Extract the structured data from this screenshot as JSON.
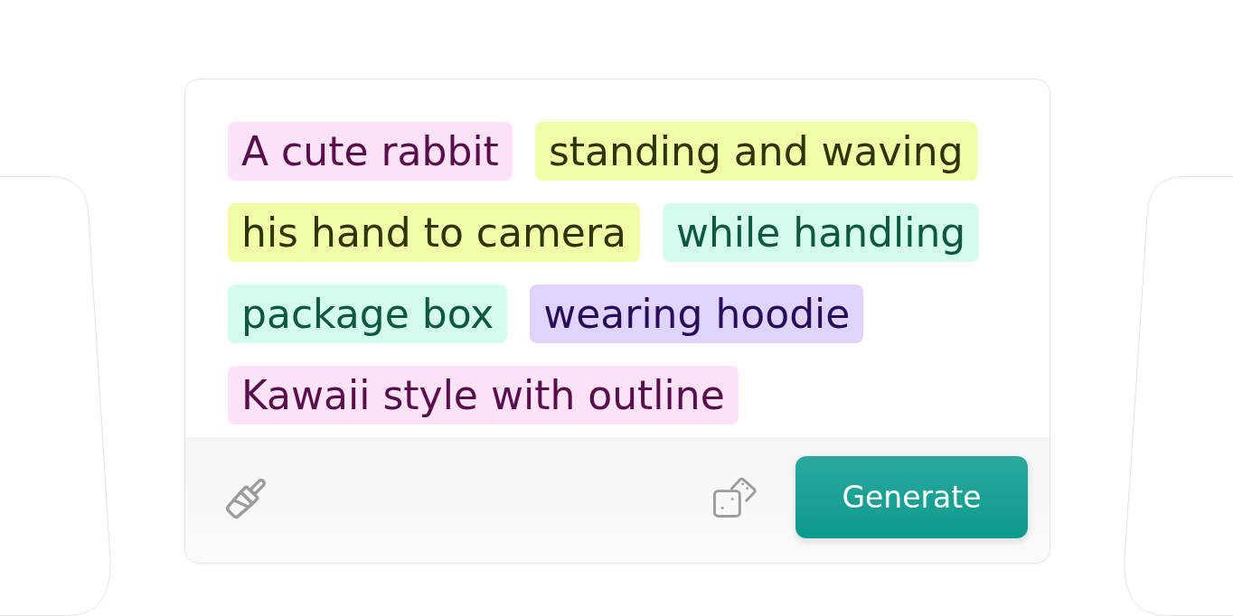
{
  "prompt": {
    "tags": [
      {
        "text": "A cute rabbit",
        "color": "#fde2f8"
      },
      {
        "text": "standing and waving",
        "color": "#f3fca7"
      },
      {
        "text": "his hand to camera",
        "color": "#f3fca7"
      },
      {
        "text": "while handling",
        "color": "#d3fcef"
      },
      {
        "text": "package box",
        "color": "#d3fcef"
      },
      {
        "text": "wearing hoodie",
        "color": "#e1d4fc"
      },
      {
        "text": "Kawaii style with outline",
        "color": "#fde2f8"
      }
    ]
  },
  "footer": {
    "generate_button": "Generate"
  }
}
